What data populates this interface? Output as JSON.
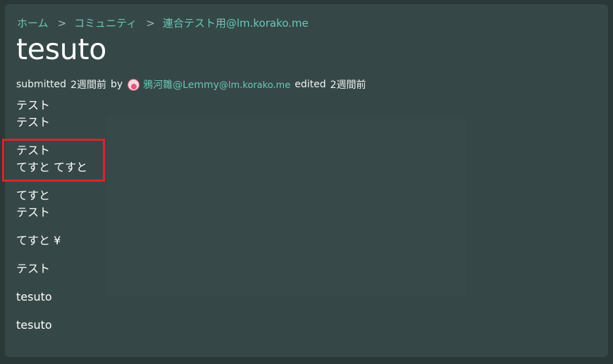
{
  "breadcrumb": {
    "home": "ホーム",
    "separator": ">",
    "community": "コミュニティ",
    "current": "連合テスト用@lm.korako.me"
  },
  "post": {
    "title": "tesuto",
    "submitted_label": "submitted",
    "submitted_time": "2週間前",
    "by_label": "by",
    "author_name": "鴉河雛@Lemmy",
    "author_instance": "@lm.korako.me",
    "edited_label": "edited",
    "edited_time": "2週間前"
  },
  "body": {
    "paragraphs": [
      [
        "テスト",
        "テスト"
      ],
      [
        "テスト",
        "てすと てすと"
      ],
      [
        "てすと",
        "テスト"
      ],
      [
        "てすと ¥"
      ],
      [
        "テスト"
      ],
      [
        "tesuto"
      ],
      [
        "tesuto"
      ]
    ]
  },
  "colors": {
    "background": "#2b3838",
    "card": "#364747",
    "link": "#6cc6b8",
    "highlight": "#d6262b"
  }
}
